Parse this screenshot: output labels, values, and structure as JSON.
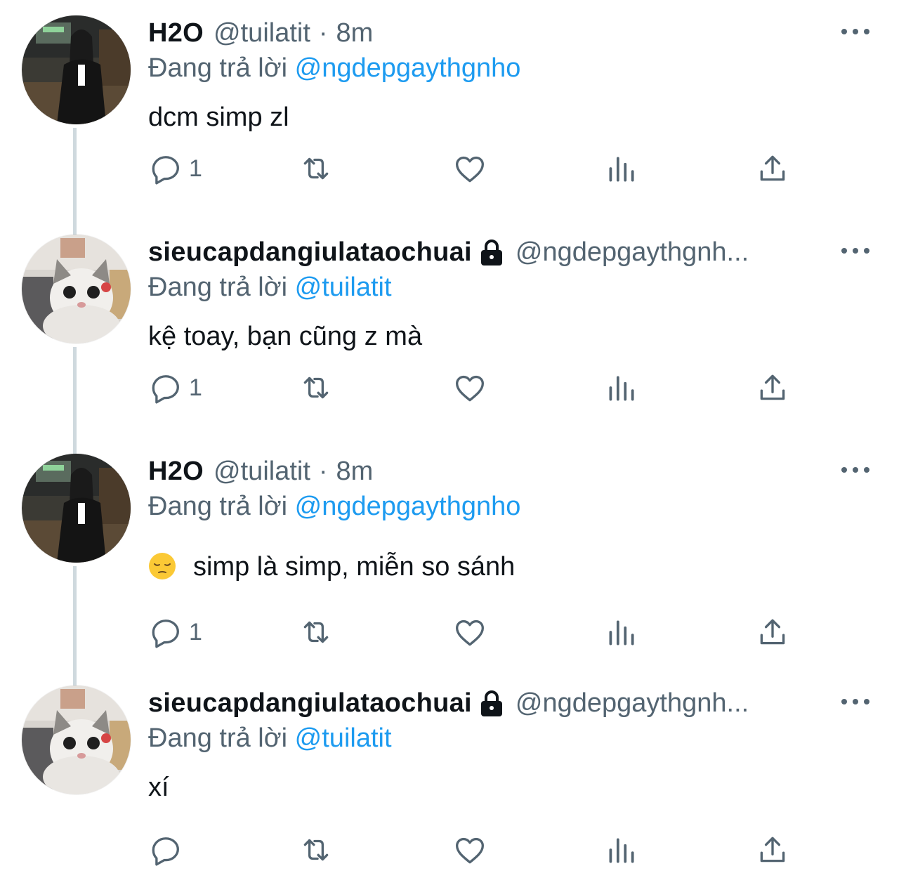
{
  "tweets": [
    {
      "display_name": "H2O",
      "handle": "@tuilatit",
      "separator": "·",
      "time": "8m",
      "replying_label": "Đang trả lời",
      "replying_to": "@ngdepgaythgnho",
      "text": "dcm simp zl",
      "reply_count": "1",
      "avatar": "girl-photo-avatar",
      "locked": false
    },
    {
      "display_name": "sieucapdangiulataochuai",
      "handle": "@ngdepgaythgnh...",
      "separator": "",
      "time": "",
      "replying_label": "Đang trả lời",
      "replying_to": "@tuilatit",
      "text": "kệ toay, bạn cũng z mà",
      "reply_count": "1",
      "avatar": "cat-photo-avatar",
      "locked": true
    },
    {
      "display_name": "H2O",
      "handle": "@tuilatit",
      "separator": "·",
      "time": "8m",
      "replying_label": "Đang trả lời",
      "replying_to": "@ngdepgaythgnho",
      "text": "simp là simp, miễn so sánh",
      "emoji": "pensive-face-emoji",
      "reply_count": "1",
      "avatar": "girl-photo-avatar",
      "locked": false
    },
    {
      "display_name": "sieucapdangiulataochuai",
      "handle": "@ngdepgaythgnh...",
      "separator": "",
      "time": "",
      "replying_label": "Đang trả lời",
      "replying_to": "@tuilatit",
      "text": "xí",
      "reply_count": "",
      "avatar": "cat-photo-avatar",
      "locked": true
    }
  ],
  "icons": {
    "reply": "reply-icon",
    "retweet": "retweet-icon",
    "like": "heart-icon",
    "views": "views-icon",
    "share": "share-icon",
    "more": "more-icon",
    "lock": "lock-icon"
  },
  "colors": {
    "mention": "#1d9bf0",
    "secondary_text": "#536471",
    "primary_text": "#0f1419",
    "thread_line": "#cfd9de"
  }
}
